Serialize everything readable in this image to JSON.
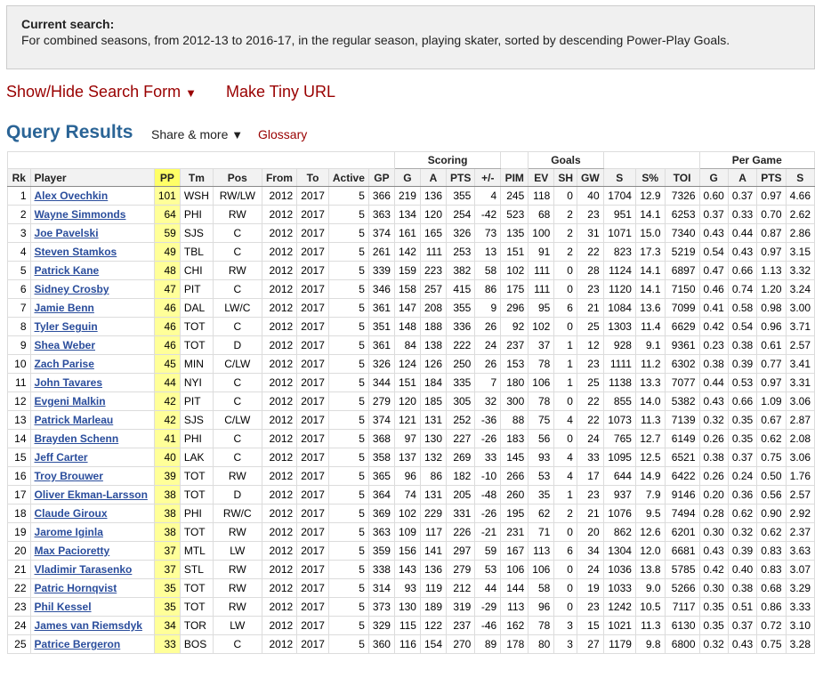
{
  "search": {
    "title": "Current search:",
    "description": "For combined seasons, from 2012-13 to 2016-17, in the regular season, playing skater, sorted by descending Power-Play Goals."
  },
  "links": {
    "show_hide": "Show/Hide Search Form",
    "tiny_url": "Make Tiny URL",
    "caret": "▼"
  },
  "results": {
    "title": "Query Results",
    "share": "Share & more",
    "share_caret": "▼",
    "glossary": "Glossary"
  },
  "table": {
    "groups": {
      "scoring": "Scoring",
      "goals": "Goals",
      "per_game": "Per Game"
    },
    "columns": [
      "Rk",
      "Player",
      "PP",
      "Tm",
      "Pos",
      "From",
      "To",
      "Active",
      "GP",
      "G",
      "A",
      "PTS",
      "+/-",
      "PIM",
      "EV",
      "SH",
      "GW",
      "S",
      "S%",
      "TOI",
      "G",
      "A",
      "PTS",
      "S"
    ],
    "rows": [
      [
        "1",
        "Alex Ovechkin",
        "101",
        "WSH",
        "RW/LW",
        "2012",
        "2017",
        "5",
        "366",
        "219",
        "136",
        "355",
        "4",
        "245",
        "118",
        "0",
        "40",
        "1704",
        "12.9",
        "7326",
        "0.60",
        "0.37",
        "0.97",
        "4.66"
      ],
      [
        "2",
        "Wayne Simmonds",
        "64",
        "PHI",
        "RW",
        "2012",
        "2017",
        "5",
        "363",
        "134",
        "120",
        "254",
        "-42",
        "523",
        "68",
        "2",
        "23",
        "951",
        "14.1",
        "6253",
        "0.37",
        "0.33",
        "0.70",
        "2.62"
      ],
      [
        "3",
        "Joe Pavelski",
        "59",
        "SJS",
        "C",
        "2012",
        "2017",
        "5",
        "374",
        "161",
        "165",
        "326",
        "73",
        "135",
        "100",
        "2",
        "31",
        "1071",
        "15.0",
        "7340",
        "0.43",
        "0.44",
        "0.87",
        "2.86"
      ],
      [
        "4",
        "Steven Stamkos",
        "49",
        "TBL",
        "C",
        "2012",
        "2017",
        "5",
        "261",
        "142",
        "111",
        "253",
        "13",
        "151",
        "91",
        "2",
        "22",
        "823",
        "17.3",
        "5219",
        "0.54",
        "0.43",
        "0.97",
        "3.15"
      ],
      [
        "5",
        "Patrick Kane",
        "48",
        "CHI",
        "RW",
        "2012",
        "2017",
        "5",
        "339",
        "159",
        "223",
        "382",
        "58",
        "102",
        "111",
        "0",
        "28",
        "1124",
        "14.1",
        "6897",
        "0.47",
        "0.66",
        "1.13",
        "3.32"
      ],
      [
        "6",
        "Sidney Crosby",
        "47",
        "PIT",
        "C",
        "2012",
        "2017",
        "5",
        "346",
        "158",
        "257",
        "415",
        "86",
        "175",
        "111",
        "0",
        "23",
        "1120",
        "14.1",
        "7150",
        "0.46",
        "0.74",
        "1.20",
        "3.24"
      ],
      [
        "7",
        "Jamie Benn",
        "46",
        "DAL",
        "LW/C",
        "2012",
        "2017",
        "5",
        "361",
        "147",
        "208",
        "355",
        "9",
        "296",
        "95",
        "6",
        "21",
        "1084",
        "13.6",
        "7099",
        "0.41",
        "0.58",
        "0.98",
        "3.00"
      ],
      [
        "8",
        "Tyler Seguin",
        "46",
        "TOT",
        "C",
        "2012",
        "2017",
        "5",
        "351",
        "148",
        "188",
        "336",
        "26",
        "92",
        "102",
        "0",
        "25",
        "1303",
        "11.4",
        "6629",
        "0.42",
        "0.54",
        "0.96",
        "3.71"
      ],
      [
        "9",
        "Shea Weber",
        "46",
        "TOT",
        "D",
        "2012",
        "2017",
        "5",
        "361",
        "84",
        "138",
        "222",
        "24",
        "237",
        "37",
        "1",
        "12",
        "928",
        "9.1",
        "9361",
        "0.23",
        "0.38",
        "0.61",
        "2.57"
      ],
      [
        "10",
        "Zach Parise",
        "45",
        "MIN",
        "C/LW",
        "2012",
        "2017",
        "5",
        "326",
        "124",
        "126",
        "250",
        "26",
        "153",
        "78",
        "1",
        "23",
        "1111",
        "11.2",
        "6302",
        "0.38",
        "0.39",
        "0.77",
        "3.41"
      ],
      [
        "11",
        "John Tavares",
        "44",
        "NYI",
        "C",
        "2012",
        "2017",
        "5",
        "344",
        "151",
        "184",
        "335",
        "7",
        "180",
        "106",
        "1",
        "25",
        "1138",
        "13.3",
        "7077",
        "0.44",
        "0.53",
        "0.97",
        "3.31"
      ],
      [
        "12",
        "Evgeni Malkin",
        "42",
        "PIT",
        "C",
        "2012",
        "2017",
        "5",
        "279",
        "120",
        "185",
        "305",
        "32",
        "300",
        "78",
        "0",
        "22",
        "855",
        "14.0",
        "5382",
        "0.43",
        "0.66",
        "1.09",
        "3.06"
      ],
      [
        "13",
        "Patrick Marleau",
        "42",
        "SJS",
        "C/LW",
        "2012",
        "2017",
        "5",
        "374",
        "121",
        "131",
        "252",
        "-36",
        "88",
        "75",
        "4",
        "22",
        "1073",
        "11.3",
        "7139",
        "0.32",
        "0.35",
        "0.67",
        "2.87"
      ],
      [
        "14",
        "Brayden Schenn",
        "41",
        "PHI",
        "C",
        "2012",
        "2017",
        "5",
        "368",
        "97",
        "130",
        "227",
        "-26",
        "183",
        "56",
        "0",
        "24",
        "765",
        "12.7",
        "6149",
        "0.26",
        "0.35",
        "0.62",
        "2.08"
      ],
      [
        "15",
        "Jeff Carter",
        "40",
        "LAK",
        "C",
        "2012",
        "2017",
        "5",
        "358",
        "137",
        "132",
        "269",
        "33",
        "145",
        "93",
        "4",
        "33",
        "1095",
        "12.5",
        "6521",
        "0.38",
        "0.37",
        "0.75",
        "3.06"
      ],
      [
        "16",
        "Troy Brouwer",
        "39",
        "TOT",
        "RW",
        "2012",
        "2017",
        "5",
        "365",
        "96",
        "86",
        "182",
        "-10",
        "266",
        "53",
        "4",
        "17",
        "644",
        "14.9",
        "6422",
        "0.26",
        "0.24",
        "0.50",
        "1.76"
      ],
      [
        "17",
        "Oliver Ekman-Larsson",
        "38",
        "TOT",
        "D",
        "2012",
        "2017",
        "5",
        "364",
        "74",
        "131",
        "205",
        "-48",
        "260",
        "35",
        "1",
        "23",
        "937",
        "7.9",
        "9146",
        "0.20",
        "0.36",
        "0.56",
        "2.57"
      ],
      [
        "18",
        "Claude Giroux",
        "38",
        "PHI",
        "RW/C",
        "2012",
        "2017",
        "5",
        "369",
        "102",
        "229",
        "331",
        "-26",
        "195",
        "62",
        "2",
        "21",
        "1076",
        "9.5",
        "7494",
        "0.28",
        "0.62",
        "0.90",
        "2.92"
      ],
      [
        "19",
        "Jarome Iginla",
        "38",
        "TOT",
        "RW",
        "2012",
        "2017",
        "5",
        "363",
        "109",
        "117",
        "226",
        "-21",
        "231",
        "71",
        "0",
        "20",
        "862",
        "12.6",
        "6201",
        "0.30",
        "0.32",
        "0.62",
        "2.37"
      ],
      [
        "20",
        "Max Pacioretty",
        "37",
        "MTL",
        "LW",
        "2012",
        "2017",
        "5",
        "359",
        "156",
        "141",
        "297",
        "59",
        "167",
        "113",
        "6",
        "34",
        "1304",
        "12.0",
        "6681",
        "0.43",
        "0.39",
        "0.83",
        "3.63"
      ],
      [
        "21",
        "Vladimir Tarasenko",
        "37",
        "STL",
        "RW",
        "2012",
        "2017",
        "5",
        "338",
        "143",
        "136",
        "279",
        "53",
        "106",
        "106",
        "0",
        "24",
        "1036",
        "13.8",
        "5785",
        "0.42",
        "0.40",
        "0.83",
        "3.07"
      ],
      [
        "22",
        "Patric Hornqvist",
        "35",
        "TOT",
        "RW",
        "2012",
        "2017",
        "5",
        "314",
        "93",
        "119",
        "212",
        "44",
        "144",
        "58",
        "0",
        "19",
        "1033",
        "9.0",
        "5266",
        "0.30",
        "0.38",
        "0.68",
        "3.29"
      ],
      [
        "23",
        "Phil Kessel",
        "35",
        "TOT",
        "RW",
        "2012",
        "2017",
        "5",
        "373",
        "130",
        "189",
        "319",
        "-29",
        "113",
        "96",
        "0",
        "23",
        "1242",
        "10.5",
        "7117",
        "0.35",
        "0.51",
        "0.86",
        "3.33"
      ],
      [
        "24",
        "James van Riemsdyk",
        "34",
        "TOR",
        "LW",
        "2012",
        "2017",
        "5",
        "329",
        "115",
        "122",
        "237",
        "-46",
        "162",
        "78",
        "3",
        "15",
        "1021",
        "11.3",
        "6130",
        "0.35",
        "0.37",
        "0.72",
        "3.10"
      ],
      [
        "25",
        "Patrice Bergeron",
        "33",
        "BOS",
        "C",
        "2012",
        "2017",
        "5",
        "360",
        "116",
        "154",
        "270",
        "89",
        "178",
        "80",
        "3",
        "27",
        "1179",
        "9.8",
        "6800",
        "0.32",
        "0.43",
        "0.75",
        "3.28"
      ]
    ]
  }
}
